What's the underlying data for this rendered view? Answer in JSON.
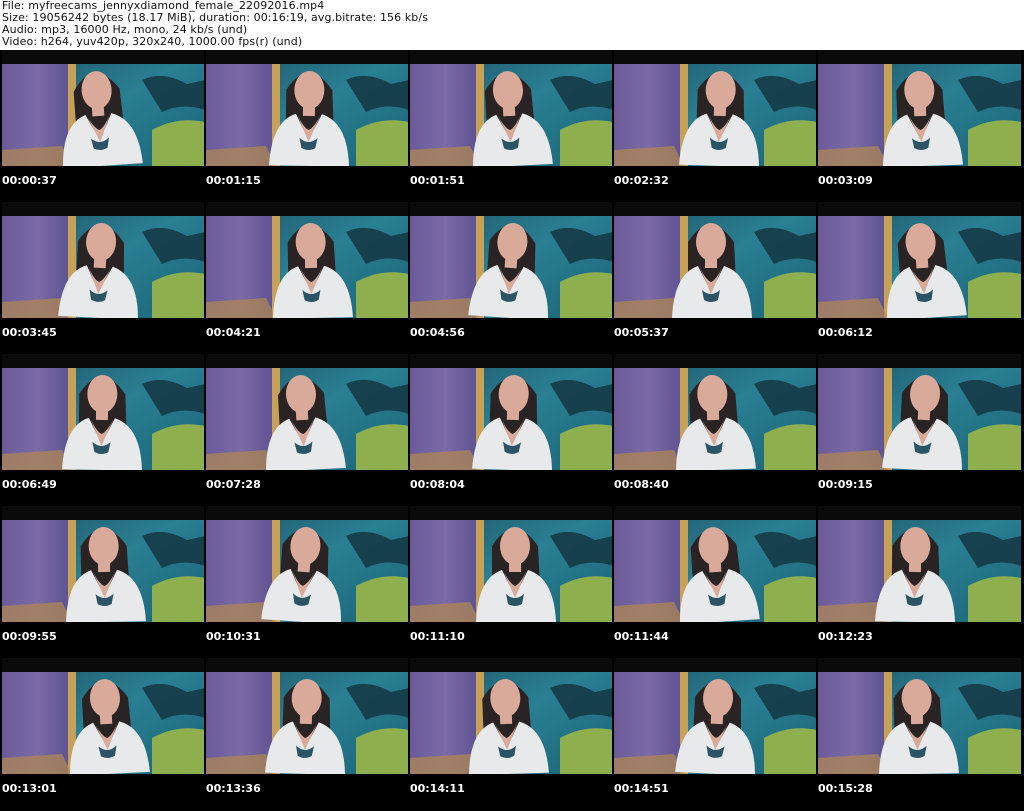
{
  "header": {
    "file_line": "File: myfreecams_jennyxdiamond_female_22092016.mp4",
    "size_line": "Size: 19056242 bytes (18.17 MiB), duration: 00:16:19, avg.bitrate: 156 kb/s",
    "audio_line": "Audio: mp3, 16000 Hz, mono, 24 kb/s (und)",
    "video_line": "Video: h264, yuv420p, 320x240, 1000.00 fps(r) (und)"
  },
  "grid": {
    "columns": 5,
    "rows": 5
  },
  "thumbnails": [
    {
      "timestamp": "00:00:37"
    },
    {
      "timestamp": "00:01:15"
    },
    {
      "timestamp": "00:01:51"
    },
    {
      "timestamp": "00:02:32"
    },
    {
      "timestamp": "00:03:09"
    },
    {
      "timestamp": "00:03:45"
    },
    {
      "timestamp": "00:04:21"
    },
    {
      "timestamp": "00:04:56"
    },
    {
      "timestamp": "00:05:37"
    },
    {
      "timestamp": "00:06:12"
    },
    {
      "timestamp": "00:06:49"
    },
    {
      "timestamp": "00:07:28"
    },
    {
      "timestamp": "00:08:04"
    },
    {
      "timestamp": "00:08:40"
    },
    {
      "timestamp": "00:09:15"
    },
    {
      "timestamp": "00:09:55"
    },
    {
      "timestamp": "00:10:31"
    },
    {
      "timestamp": "00:11:10"
    },
    {
      "timestamp": "00:11:44"
    },
    {
      "timestamp": "00:12:23"
    },
    {
      "timestamp": "00:13:01"
    },
    {
      "timestamp": "00:13:36"
    },
    {
      "timestamp": "00:14:11"
    },
    {
      "timestamp": "00:14:51"
    },
    {
      "timestamp": "00:15:28"
    }
  ],
  "colors": {
    "sheet_background": "#000000",
    "header_background": "#ffffff",
    "header_text": "#111111",
    "timestamp_text": "#ffffff",
    "curtain_purple": "#7b6aa6",
    "water_teal": "#2a7f92",
    "pillow_green": "#8fae4e",
    "shirt_white": "#e7e9ea",
    "hair_dark": "#2a2324",
    "skin": "#d9a99a"
  }
}
